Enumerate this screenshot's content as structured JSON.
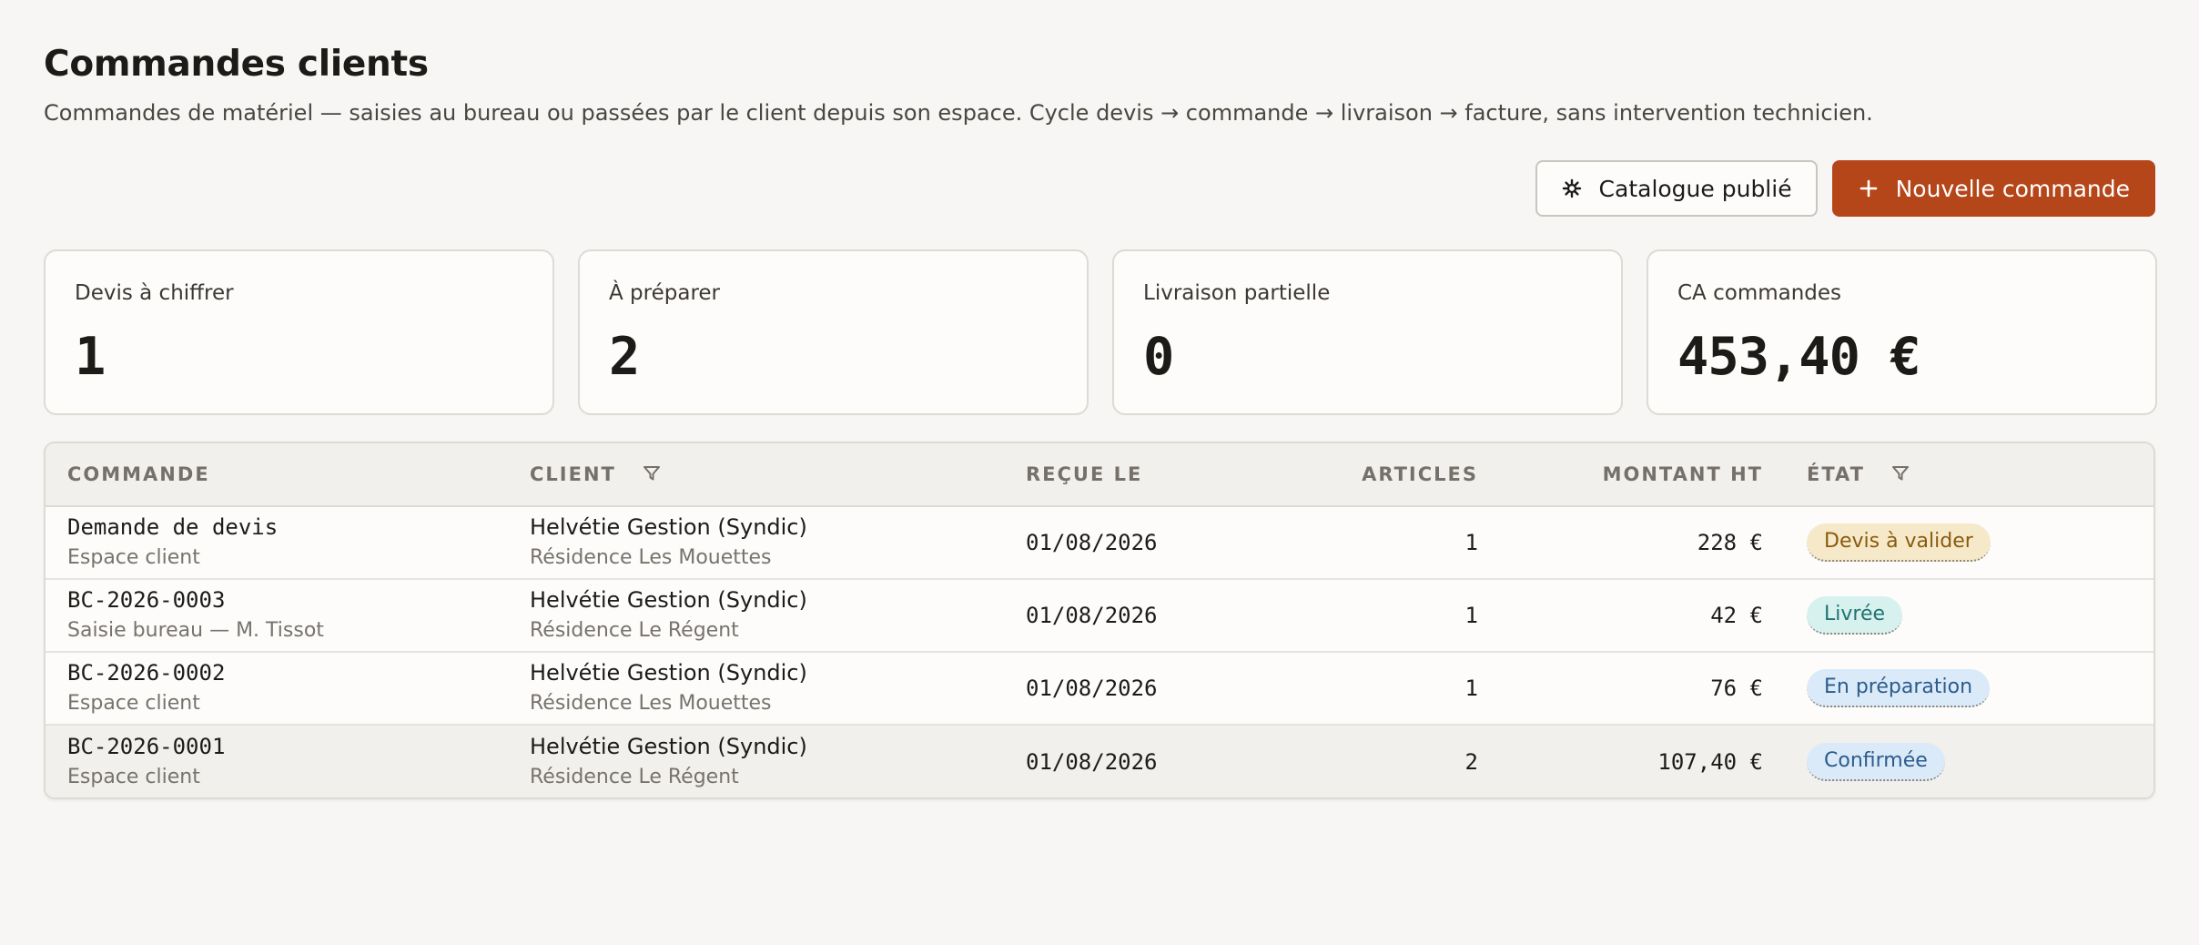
{
  "page": {
    "title": "Commandes clients",
    "subtitle": "Commandes de matériel — saisies au bureau ou passées par le client depuis son espace. Cycle devis → commande → livraison → facture, sans intervention technicien."
  },
  "actions": {
    "catalogue_label": "Catalogue publié",
    "new_order_label": "Nouvelle commande"
  },
  "stats": [
    {
      "label": "Devis à chiffrer",
      "value": "1"
    },
    {
      "label": "À préparer",
      "value": "2"
    },
    {
      "label": "Livraison partielle",
      "value": "0"
    },
    {
      "label": "CA commandes",
      "value": "453,40 €"
    }
  ],
  "table": {
    "columns": {
      "commande": "Commande",
      "client": "Client",
      "recue_le": "Reçue le",
      "articles": "Articles",
      "montant_ht": "Montant HT",
      "etat": "État"
    },
    "rows": [
      {
        "ref": "Demande de devis",
        "source": "Espace client",
        "client": "Helvétie Gestion (Syndic)",
        "residence": "Résidence Les Mouettes",
        "date": "01/08/2026",
        "articles": "1",
        "montant": "228 €",
        "etat": "Devis à valider"
      },
      {
        "ref": "BC-2026-0003",
        "source": "Saisie bureau — M. Tissot",
        "client": "Helvétie Gestion (Syndic)",
        "residence": "Résidence Le Régent",
        "date": "01/08/2026",
        "articles": "1",
        "montant": "42 €",
        "etat": "Livrée"
      },
      {
        "ref": "BC-2026-0002",
        "source": "Espace client",
        "client": "Helvétie Gestion (Syndic)",
        "residence": "Résidence Les Mouettes",
        "date": "01/08/2026",
        "articles": "1",
        "montant": "76 €",
        "etat": "En préparation"
      },
      {
        "ref": "BC-2026-0001",
        "source": "Espace client",
        "client": "Helvétie Gestion (Syndic)",
        "residence": "Résidence Le Régent",
        "date": "01/08/2026",
        "articles": "2",
        "montant": "107,40 €",
        "etat": "Confirmée"
      }
    ]
  },
  "colors": {
    "accent": "#b5461a",
    "badge_amber": "#f6e9c9",
    "badge_teal": "#d7f1ef",
    "badge_blue": "#dbeaf8"
  },
  "icons": {
    "catalogue": "asterisk-icon",
    "new_order": "plus-icon",
    "filter": "filter-icon"
  }
}
